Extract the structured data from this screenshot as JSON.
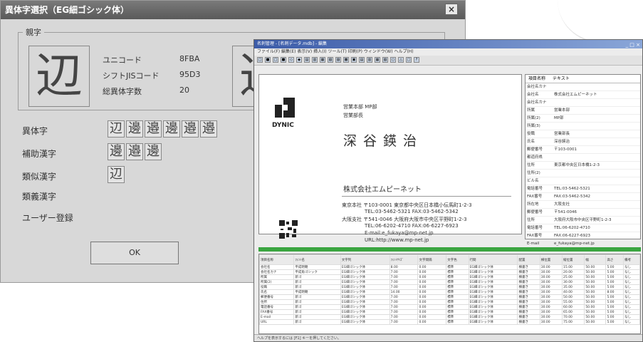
{
  "dialog": {
    "title": "異体字選択（EG細ゴシック体）",
    "close_label": "×",
    "group_label": "親字",
    "big_kanji": "辺",
    "big_kanji_partial": "辺",
    "info": [
      {
        "label": "ユニコード",
        "value": "8FBA"
      },
      {
        "label": "シフトJISコード",
        "value": "95D3"
      },
      {
        "label": "総異体字数",
        "value": "20"
      }
    ],
    "rows": [
      {
        "label": "異体字",
        "glyphs": [
          "辺",
          "邊",
          "邉",
          "邊",
          "邉",
          "邉"
        ]
      },
      {
        "label": "補助漢字",
        "glyphs": [
          "邊",
          "邉",
          "邊"
        ]
      },
      {
        "label": "類似漢字",
        "glyphs": [
          "辺"
        ]
      },
      {
        "label": "類義漢字",
        "glyphs": []
      },
      {
        "label": "ユーザー登録",
        "glyphs": []
      }
    ],
    "ok_label": "OK"
  },
  "app": {
    "title": "名刺管理 - [名刺データ.mdb] - 編集",
    "menu": "ファイル(F)  編集(E)  表示(V)  挿入(I)  ツール(T)  印刷(P)  ウィンドウ(W)  ヘルプ(H)",
    "toolbar_icons": [
      "□",
      "■",
      "□",
      "■",
      "◇",
      "◆",
      "▤",
      "▥",
      "▦",
      "▧",
      "▨",
      "▩",
      "▣",
      "▤",
      "▥",
      "▦",
      "▧",
      "○",
      "△",
      "□",
      "?"
    ],
    "card": {
      "logo_text": "DYNIC",
      "dept": "営業本部 MP部",
      "title": "営業部長",
      "name": "深谷鍈治",
      "company": "株式会社エムピーネット",
      "addr_lines": [
        "東京本社 〒103-0001 東京都中央区日本橋小伝馬町1-2-3",
        "TEL:03-5462-5321 FAX:03-5462-5342",
        "大阪支社 〒541-0046 大阪府大阪市中央区平野町1-2-3",
        "TEL:06-6202-4710 FAX:06-6227-6923",
        "E-mail:e_fukaya@mp-net.jp",
        "URL:http://www.mp-net.jp"
      ]
    },
    "panel": {
      "header_label": "項目名称",
      "header_value": "テキスト",
      "rows": [
        {
          "k": "会社名カナ",
          "v": ""
        },
        {
          "k": "会社名",
          "v": "株式会社エムピーネット"
        },
        {
          "k": "会社名カナ",
          "v": ""
        },
        {
          "k": "所属",
          "v": "営業本部"
        },
        {
          "k": "所属(2)",
          "v": "MP部"
        },
        {
          "k": "所属(3)",
          "v": ""
        },
        {
          "k": "役職",
          "v": "営業部長"
        },
        {
          "k": "氏名",
          "v": "深谷鍈治"
        },
        {
          "k": "郵便番号",
          "v": "〒103-0001"
        },
        {
          "k": "都道府県",
          "v": ""
        },
        {
          "k": "住所",
          "v": "東京都中央区日本橋1-2-3"
        },
        {
          "k": "住所(2)",
          "v": ""
        },
        {
          "k": "ビル名",
          "v": ""
        },
        {
          "k": "電話番号",
          "v": "TEL:03-5462-5321"
        },
        {
          "k": "FAX番号",
          "v": "FAX:03-5462-5342"
        },
        {
          "k": "所在地",
          "v": "大阪支社"
        },
        {
          "k": "郵便番号",
          "v": "〒541-0046"
        },
        {
          "k": "住所",
          "v": "大阪府大阪市中央区平野町1-2-3"
        },
        {
          "k": "電話番号",
          "v": "TEL:06-6202-4710"
        },
        {
          "k": "FAX番号",
          "v": "FAX:06-6227-6923"
        },
        {
          "k": "E-mail",
          "v": "e_fukaya@mp-net.jp"
        }
      ]
    },
    "grid": {
      "headers": [
        "項目名称",
        "ﾌｫﾝﾄ名",
        "文字列",
        "ﾌｫﾝﾄｻｲｽﾞ",
        "文字間隔",
        "文字色",
        "行間",
        "配置",
        "横位置",
        "縦位置",
        "幅",
        "高さ",
        "備考"
      ],
      "rows": [
        [
          "会社名",
          "平成明朝",
          "EG細ゴシック体",
          "8.00",
          "0.00",
          "標準",
          "EG細ゴシック体",
          "横書き",
          "30.00",
          "15.00",
          "50.00",
          "5.00",
          "なし"
        ],
        [
          "会社名カナ",
          "平成角ゴシック",
          "EG細ゴシック体",
          "7.00",
          "0.00",
          "標準",
          "EG細ゴシック体",
          "横書き",
          "30.00",
          "20.00",
          "50.00",
          "5.00",
          "なし"
        ],
        [
          "所属",
          "新ゴ",
          "EG細ゴシック体",
          "7.00",
          "0.00",
          "標準",
          "EG細ゴシック体",
          "横書き",
          "30.00",
          "25.00",
          "50.00",
          "5.00",
          "なし"
        ],
        [
          "所属(2)",
          "新ゴ",
          "EG細ゴシック体",
          "7.00",
          "0.00",
          "標準",
          "EG細ゴシック体",
          "横書き",
          "30.00",
          "30.00",
          "50.00",
          "5.00",
          "なし"
        ],
        [
          "役職",
          "新ゴ",
          "EG細ゴシック体",
          "7.00",
          "0.00",
          "標準",
          "EG細ゴシック体",
          "横書き",
          "30.00",
          "35.00",
          "50.00",
          "5.00",
          "なし"
        ],
        [
          "氏名",
          "平成明朝",
          "EG細ゴシック体",
          "14.00",
          "0.00",
          "標準",
          "EG細ゴシック体",
          "横書き",
          "30.00",
          "40.00",
          "50.00",
          "8.00",
          "なし"
        ],
        [
          "郵便番号",
          "新ゴ",
          "EG細ゴシック体",
          "7.00",
          "0.00",
          "標準",
          "EG細ゴシック体",
          "横書き",
          "30.00",
          "50.00",
          "50.00",
          "5.00",
          "なし"
        ],
        [
          "住所",
          "新ゴ",
          "EG細ゴシック体",
          "7.00",
          "0.00",
          "標準",
          "EG細ゴシック体",
          "横書き",
          "30.00",
          "55.00",
          "50.00",
          "5.00",
          "なし"
        ],
        [
          "電話番号",
          "新ゴ",
          "EG細ゴシック体",
          "7.00",
          "0.00",
          "標準",
          "EG細ゴシック体",
          "横書き",
          "30.00",
          "60.00",
          "50.00",
          "5.00",
          "なし"
        ],
        [
          "FAX番号",
          "新ゴ",
          "EG細ゴシック体",
          "7.00",
          "0.00",
          "標準",
          "EG細ゴシック体",
          "横書き",
          "30.00",
          "65.00",
          "50.00",
          "5.00",
          "なし"
        ],
        [
          "E-mail",
          "新ゴ",
          "EG細ゴシック体",
          "7.00",
          "0.00",
          "標準",
          "EG細ゴシック体",
          "横書き",
          "30.00",
          "70.00",
          "50.00",
          "5.00",
          "なし"
        ],
        [
          "URL",
          "新ゴ",
          "EG細ゴシック体",
          "7.00",
          "0.00",
          "標準",
          "EG細ゴシック体",
          "横書き",
          "30.00",
          "75.00",
          "50.00",
          "5.00",
          "なし"
        ]
      ]
    },
    "status": "ヘルプを表示するには [F1] キーを押してください。"
  }
}
